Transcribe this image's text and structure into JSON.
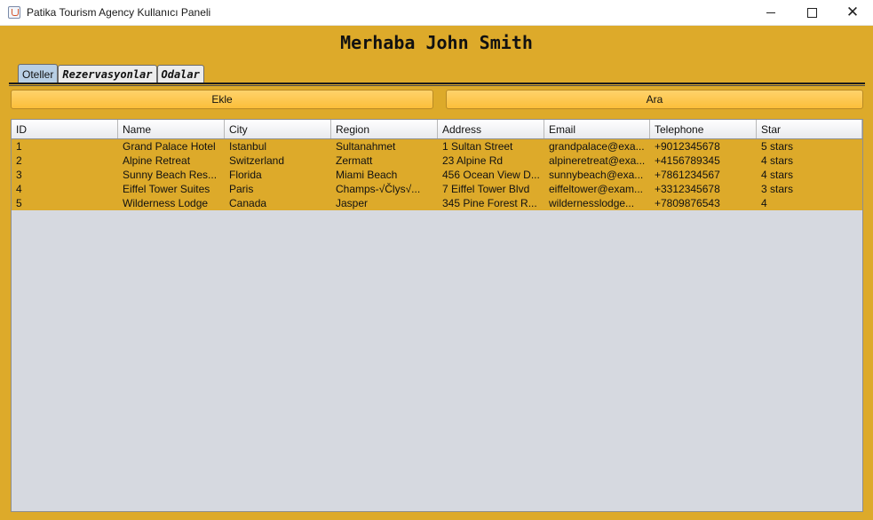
{
  "window": {
    "title": "Patika Tourism Agency Kullanıcı Paneli",
    "icon": "java-cup-icon",
    "controls": {
      "minimize": "minimize-icon",
      "maximize": "maximize-icon",
      "close": "✕"
    }
  },
  "greeting": "Merhaba John Smith",
  "tabs": [
    {
      "label": "Oteller",
      "active": true
    },
    {
      "label": "Rezervasyonlar",
      "active": false
    },
    {
      "label": "Odalar",
      "active": false
    }
  ],
  "buttons": {
    "add": "Ekle",
    "search": "Ara"
  },
  "table": {
    "columns": [
      "ID",
      "Name",
      "City",
      "Region",
      "Address",
      "Email",
      "Telephone",
      "Star"
    ],
    "rows": [
      [
        "1",
        "Grand Palace Hotel",
        "Istanbul",
        "Sultanahmet",
        "1 Sultan Street",
        "grandpalace@exa...",
        "+9012345678",
        "5 stars"
      ],
      [
        "2",
        "Alpine Retreat",
        "Switzerland",
        "Zermatt",
        "23 Alpine Rd",
        "alpineretreat@exa...",
        "+4156789345",
        "4 stars"
      ],
      [
        "3",
        "Sunny Beach Res...",
        "Florida",
        "Miami Beach",
        "456 Ocean View D...",
        "sunnybeach@exa...",
        "+7861234567",
        "4 stars"
      ],
      [
        "4",
        "Eiffel Tower Suites",
        "Paris",
        "Champs-√Člys√...",
        "7 Eiffel Tower Blvd",
        "eiffeltower@exam...",
        "+3312345678",
        "3 stars"
      ],
      [
        "5",
        "Wilderness Lodge",
        "Canada",
        "Jasper",
        "345 Pine Forest R...",
        "wildernesslodge...",
        "+7809876543",
        "4"
      ]
    ]
  },
  "colors": {
    "background": "#ddaa2a",
    "button": "#fbbf3a",
    "active_tab": "#b8cfe5",
    "table_empty": "#d6d9e0"
  }
}
